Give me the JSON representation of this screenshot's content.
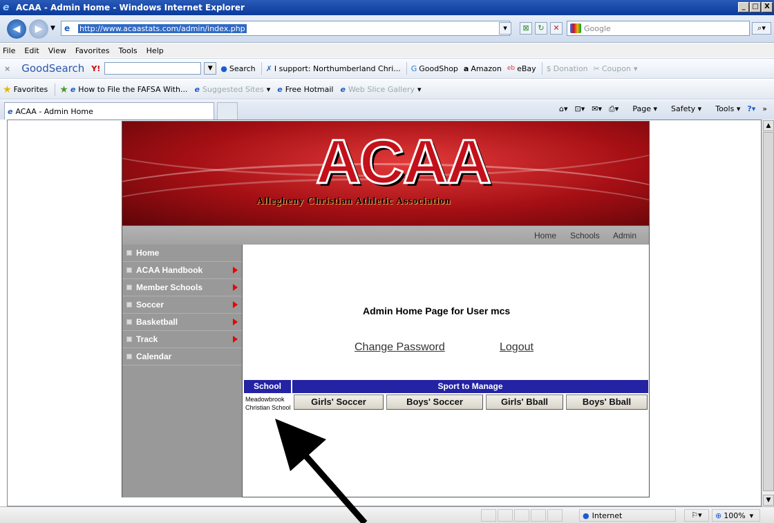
{
  "window": {
    "title": "ACAA - Admin Home - Windows Internet Explorer",
    "min": "_",
    "max": "□",
    "close": "X"
  },
  "address": {
    "url": "http://www.acaastats.com/admin/index.php",
    "search_placeholder": "Google"
  },
  "menu": [
    "File",
    "Edit",
    "View",
    "Favorites",
    "Tools",
    "Help"
  ],
  "toolbar": {
    "goodsearch": "GoodSearch",
    "search_label": "Search",
    "support": "I support: Northumberland Chri...",
    "goodshop": "GoodShop",
    "amazon": "Amazon",
    "ebay": "eBay",
    "donation": "Donation",
    "coupon": "Coupon"
  },
  "favorites": {
    "label": "Favorites",
    "items": [
      "How to File the FAFSA With...",
      "Suggested Sites",
      "Free Hotmail",
      "Web Slice Gallery"
    ]
  },
  "tab": {
    "title": "ACAA - Admin Home"
  },
  "commands": [
    "Page",
    "Safety",
    "Tools"
  ],
  "status": {
    "zone": "Internet",
    "zoom": "100%"
  },
  "site": {
    "logo": "ACAA",
    "subtitle": "Allegheny Christian Athletic Association",
    "topnav": [
      "Home",
      "Schools",
      "Admin"
    ],
    "sidebar": [
      {
        "label": "Home",
        "submenu": false
      },
      {
        "label": "ACAA Handbook",
        "submenu": true
      },
      {
        "label": "Member Schools",
        "submenu": true
      },
      {
        "label": "Soccer",
        "submenu": true
      },
      {
        "label": "Basketball",
        "submenu": true
      },
      {
        "label": "Track",
        "submenu": true
      },
      {
        "label": "Calendar",
        "submenu": false
      }
    ],
    "heading": "Admin Home Page for User mcs",
    "change_password": "Change Password",
    "logout": "Logout",
    "table": {
      "school_header": "School",
      "sport_header": "Sport to Manage",
      "school_name": "Meadowbrook Christian School",
      "sports": [
        "Girls' Soccer",
        "Boys' Soccer",
        "Girls' Bball",
        "Boys' Bball"
      ]
    }
  },
  "colors": {
    "accent": "#2323a3",
    "banner": "#a40f14",
    "sidebar": "#999999"
  }
}
